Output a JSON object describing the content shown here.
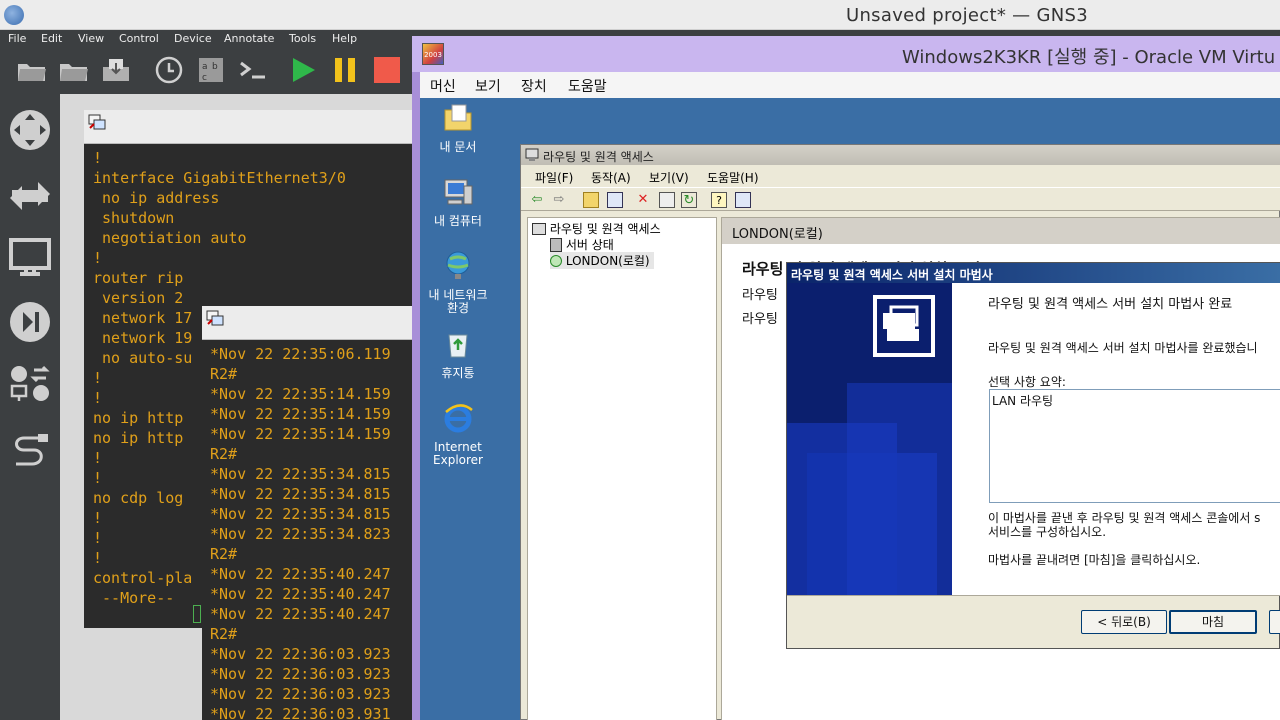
{
  "gns3": {
    "title": "Unsaved project* — GNS3",
    "menu": [
      "File",
      "Edit",
      "View",
      "Control",
      "Device",
      "Annotate",
      "Tools",
      "Help"
    ],
    "console1_lines": [
      "!",
      "interface GigabitEthernet3/0",
      " no ip address",
      " shutdown",
      " negotiation auto",
      "!",
      "router rip",
      " version 2",
      " network 17",
      " network 19",
      " no auto-su",
      "!",
      "!",
      "no ip http",
      "no ip http",
      "!",
      "!",
      "no cdp log",
      "!",
      "!",
      "!",
      "control-pla",
      " --More-- "
    ],
    "console2_lines": [
      "*Nov 22 22:35:06.119",
      "R2#",
      "*Nov 22 22:35:14.159",
      "*Nov 22 22:35:14.159",
      "*Nov 22 22:35:14.159",
      "R2#",
      "*Nov 22 22:35:34.815",
      "*Nov 22 22:35:34.815",
      "*Nov 22 22:35:34.815",
      "*Nov 22 22:35:34.823",
      "R2#",
      "*Nov 22 22:35:40.247",
      "*Nov 22 22:35:40.247",
      "*Nov 22 22:35:40.247",
      "R2#",
      "*Nov 22 22:36:03.923",
      "*Nov 22 22:36:03.923",
      "*Nov 22 22:36:03.923",
      "*Nov 22 22:36:03.931"
    ],
    "colors": {
      "console_text": "#e0a01a",
      "console_bg": "#2b2b2b",
      "play": "#2fb84a",
      "pause": "#f2c21b",
      "stop": "#f05a4a"
    }
  },
  "vbox": {
    "title": "Windows2K3KR [실행 중] - Oracle VM Virtu",
    "icon_label": "2003",
    "menu": [
      "머신",
      "보기",
      "장치",
      "도움말"
    ]
  },
  "desktop": {
    "icons": [
      {
        "label": "내 문서"
      },
      {
        "label": "내 컴퓨터"
      },
      {
        "label": "내 네트워크\n환경"
      },
      {
        "label": "휴지통"
      },
      {
        "label": "Internet\nExplorer"
      }
    ]
  },
  "mmc": {
    "title": "라우팅 및 원격 액세스",
    "menu": [
      "파일(F)",
      "동작(A)",
      "보기(V)",
      "도움말(H)"
    ],
    "tree": [
      "라우팅 및 원격 액세스",
      "서버 상태",
      "LONDON(로컬)"
    ],
    "right_header": "LONDON(로컬)",
    "right_heading": "라우팅 및 원격 액세스 서버 설치 구성",
    "right_side_labels": [
      "라우팅",
      "라우팅"
    ]
  },
  "wizard": {
    "title": "라우팅 및 원격 액세스 서버 설치 마법사",
    "heading": "라우팅 및 원격 액세스 서버 설치 마법사 완료",
    "line1": "라우팅 및 원격 액세스 서버 설치 마법사를 완료했습니",
    "summary_label": "선택 사항 요약:",
    "summary_value": "LAN 라우팅",
    "line2": "이 마법사를 끝낸 후 라우팅 및 원격 액세스 콘솔에서 s\n서비스를 구성하십시오.",
    "line3": "마법사를 끝내려면 [마침]을 클릭하십시오.",
    "back_button": "< 뒤로(B)",
    "finish_button": "마침"
  }
}
